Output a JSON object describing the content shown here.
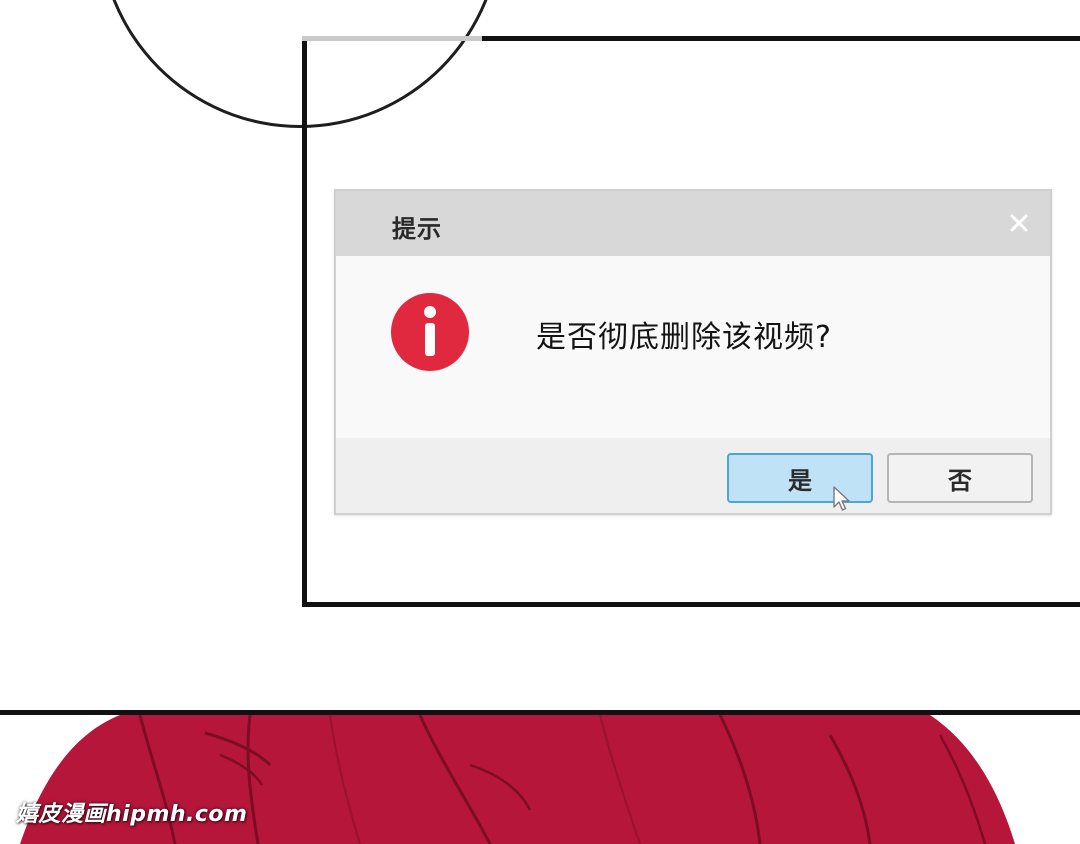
{
  "dialog": {
    "title": "提示",
    "message": "是否彻底删除该视频?",
    "icon": "info-icon",
    "icon_color": "#e0283f",
    "buttons": {
      "yes_label": "是",
      "no_label": "否"
    }
  },
  "watermark": {
    "text": "嬉皮漫画hipmh.com"
  },
  "colors": {
    "titlebar": "#d8d8d8",
    "primary_button_fill": "#bfe2f6",
    "primary_button_border": "#4aa6d9",
    "hair": "#b5163a"
  }
}
